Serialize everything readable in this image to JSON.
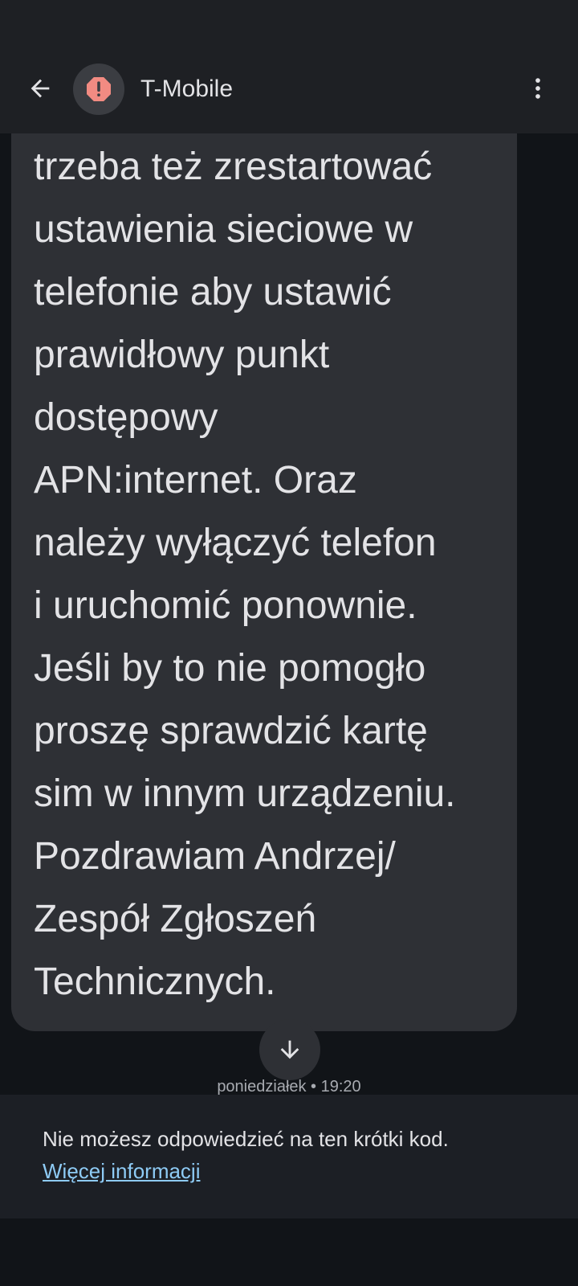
{
  "header": {
    "title": "T-Mobile",
    "back_icon": "arrow-back-icon",
    "avatar_icon": "alert-octagon-icon",
    "avatar_icon_color": "#f28b82",
    "more_icon": "more-vert-icon"
  },
  "message": {
    "body": "trzeba też zrestartować\nustawienia sieciowe w\ntelefonie aby ustawić\nprawidłowy punkt\ndostępowy\nAPN:internet. Oraz\nnależy wyłączyć telefon\ni uruchomić ponownie.\nJeśli by to nie pomogło\nproszę sprawdzić kartę\nsim w innym urządzeniu.\nPozdrawiam Andrzej/\nZespół Zgłoszeń\nTechnicznych.",
    "timestamp": "poniedziałek • 19:20"
  },
  "scroll_down": {
    "icon": "arrow-down-icon"
  },
  "notice": {
    "text": "Nie możesz odpowiedzieć na ten krótki kod.",
    "link": "Więcej informacji"
  },
  "colors": {
    "background": "#111418",
    "app_bar": "#1e2024",
    "bubble": "#2e3035",
    "link": "#8ecbf5",
    "alert": "#f28b82"
  }
}
